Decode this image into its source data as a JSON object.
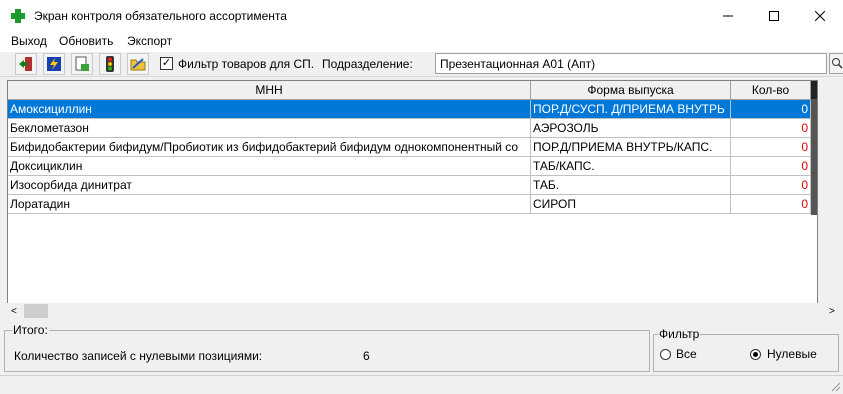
{
  "window": {
    "title": "Экран контроля обязательного ассортимента"
  },
  "menu": {
    "items": [
      "Выход",
      "Обновить",
      "Экспорт"
    ]
  },
  "toolbar": {
    "buttons": [
      "exit-door-icon",
      "flash-icon",
      "document-icon",
      "traffic-light-icon",
      "folder-icon"
    ],
    "filter_checked": true,
    "filter_label": "Фильтр товаров для СП.",
    "dept_label": "Подразделение:",
    "dept_value": "Презентационная А01 (Апт)"
  },
  "grid": {
    "headers": [
      "МНН",
      "Форма выпуска",
      "Кол-во"
    ],
    "rows": [
      {
        "mnn": "Амоксициллин",
        "form": "ПОР.Д/СУСП. Д/ПРИЕМА ВНУТРЬ",
        "qty": "0",
        "selected": true
      },
      {
        "mnn": "Беклометазон",
        "form": "АЭРОЗОЛЬ",
        "qty": "0"
      },
      {
        "mnn": "Бифидобактерии бифидум/Пробиотик из бифидобактерий бифидум однокомпонентный со",
        "form": "ПОР.Д/ПРИЕМА ВНУТРЬ/КАПС.",
        "qty": "0"
      },
      {
        "mnn": "Доксициклин",
        "form": "ТАБ/КАПС.",
        "qty": "0"
      },
      {
        "mnn": "Изосорбида динитрат",
        "form": "ТАБ.",
        "qty": "0"
      },
      {
        "mnn": "Лоратадин",
        "form": "СИРОП",
        "qty": "0"
      }
    ]
  },
  "summary": {
    "title": "Итого:",
    "label": "Количество записей с нулевыми  позициями:",
    "value": "6"
  },
  "filter": {
    "title": "Фильтр",
    "options": [
      "Все",
      "Нулевые"
    ],
    "selected": "Нулевые"
  },
  "colors": {
    "selection": "#0078d7",
    "zero_qty": "#e00000"
  }
}
